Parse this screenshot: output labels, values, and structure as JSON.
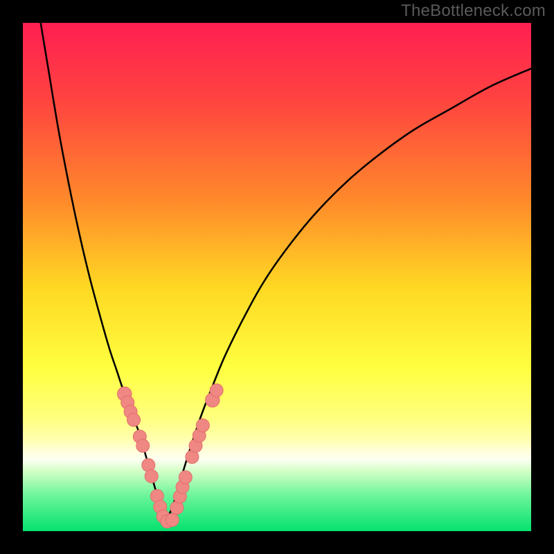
{
  "watermark": "TheBottleneck.com",
  "colors": {
    "black": "#000000",
    "curve": "#000000",
    "marker_fill": "#ef8783",
    "marker_stroke": "#e06b66"
  },
  "chart_data": {
    "type": "line",
    "title": "",
    "xlabel": "",
    "ylabel": "",
    "xlim": [
      0,
      100
    ],
    "ylim": [
      0,
      100
    ],
    "gradient_stops": [
      {
        "offset": 0.0,
        "color": "#ff1f52"
      },
      {
        "offset": 0.15,
        "color": "#ff4340"
      },
      {
        "offset": 0.35,
        "color": "#ff8a2b"
      },
      {
        "offset": 0.52,
        "color": "#ffd823"
      },
      {
        "offset": 0.68,
        "color": "#ffff40"
      },
      {
        "offset": 0.78,
        "color": "#ffff80"
      },
      {
        "offset": 0.82,
        "color": "#ffffb0"
      },
      {
        "offset": 0.845,
        "color": "#ffffe0"
      },
      {
        "offset": 0.86,
        "color": "#fbfff0"
      },
      {
        "offset": 0.88,
        "color": "#d6ffc8"
      },
      {
        "offset": 0.93,
        "color": "#6cf59a"
      },
      {
        "offset": 1.0,
        "color": "#05e26e"
      }
    ],
    "series": [
      {
        "name": "left-branch",
        "x": [
          3.5,
          5.0,
          7.0,
          9.0,
          11.0,
          13.0,
          15.0,
          17.0,
          18.5,
          20.0,
          21.5,
          23.0,
          24.0,
          25.0,
          26.0,
          27.0,
          28.0
        ],
        "y": [
          100.0,
          91.0,
          79.0,
          68.5,
          59.0,
          50.5,
          43.0,
          36.0,
          31.5,
          27.0,
          23.0,
          19.0,
          15.5,
          12.0,
          8.5,
          5.0,
          1.5
        ]
      },
      {
        "name": "right-branch",
        "x": [
          28.0,
          29.5,
          31.0,
          33.0,
          35.0,
          37.5,
          40.0,
          44.0,
          48.0,
          53.0,
          58.0,
          64.0,
          70.0,
          77.0,
          84.0,
          92.0,
          100.0
        ],
        "y": [
          1.5,
          5.0,
          10.0,
          16.5,
          22.5,
          29.0,
          35.0,
          43.0,
          50.0,
          57.0,
          63.0,
          69.0,
          74.0,
          79.0,
          83.0,
          87.5,
          91.0
        ]
      }
    ],
    "markers": [
      {
        "x": 20.0,
        "y": 27.0,
        "r": 1.4
      },
      {
        "x": 20.6,
        "y": 25.3,
        "r": 1.3
      },
      {
        "x": 21.2,
        "y": 23.5,
        "r": 1.3
      },
      {
        "x": 21.8,
        "y": 21.9,
        "r": 1.3
      },
      {
        "x": 23.0,
        "y": 18.6,
        "r": 1.3
      },
      {
        "x": 23.6,
        "y": 16.8,
        "r": 1.3
      },
      {
        "x": 24.7,
        "y": 13.0,
        "r": 1.3
      },
      {
        "x": 25.3,
        "y": 10.8,
        "r": 1.3
      },
      {
        "x": 26.4,
        "y": 6.9,
        "r": 1.3
      },
      {
        "x": 27.0,
        "y": 4.8,
        "r": 1.3
      },
      {
        "x": 27.6,
        "y": 2.9,
        "r": 1.3
      },
      {
        "x": 28.4,
        "y": 1.9,
        "r": 1.3
      },
      {
        "x": 29.4,
        "y": 2.2,
        "r": 1.3
      },
      {
        "x": 30.3,
        "y": 4.6,
        "r": 1.3
      },
      {
        "x": 30.9,
        "y": 6.8,
        "r": 1.3
      },
      {
        "x": 31.4,
        "y": 8.7,
        "r": 1.3
      },
      {
        "x": 32.0,
        "y": 10.6,
        "r": 1.3
      },
      {
        "x": 33.3,
        "y": 14.6,
        "r": 1.3
      },
      {
        "x": 34.0,
        "y": 16.8,
        "r": 1.3
      },
      {
        "x": 34.7,
        "y": 18.8,
        "r": 1.3
      },
      {
        "x": 35.4,
        "y": 20.8,
        "r": 1.3
      },
      {
        "x": 37.3,
        "y": 25.8,
        "r": 1.4
      },
      {
        "x": 38.1,
        "y": 27.7,
        "r": 1.3
      }
    ]
  }
}
